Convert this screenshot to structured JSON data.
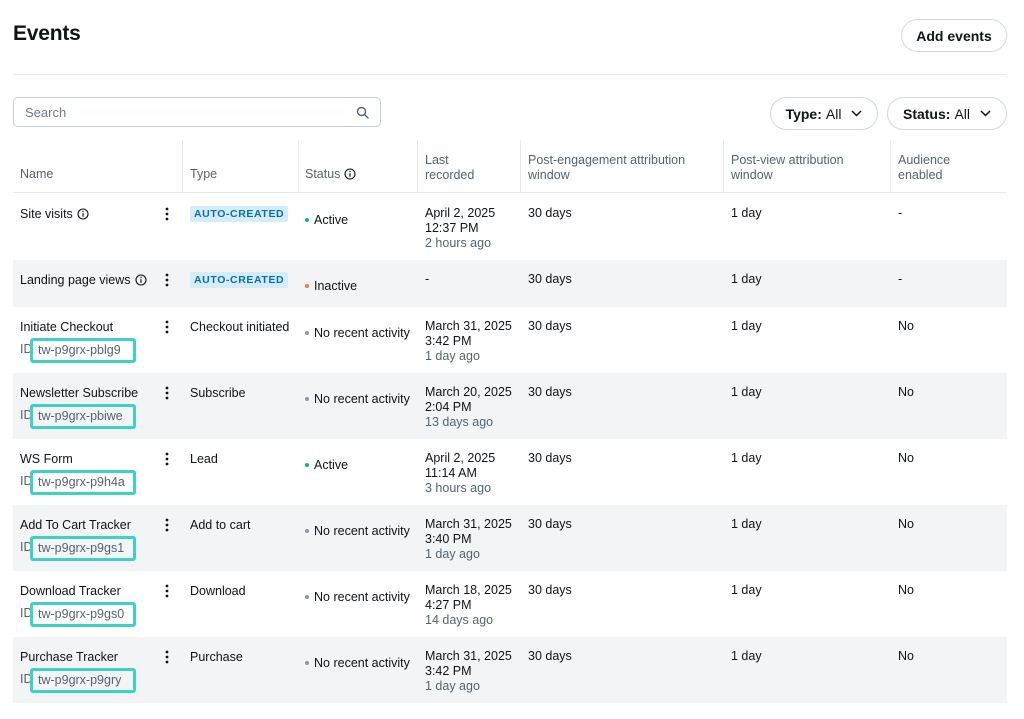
{
  "header": {
    "title": "Events",
    "add_button": "Add events"
  },
  "search": {
    "placeholder": "Search"
  },
  "filters": {
    "type": {
      "label": "Type:",
      "value": "All"
    },
    "status": {
      "label": "Status:",
      "value": "All"
    }
  },
  "columns": {
    "name": "Name",
    "type": "Type",
    "status": "Status",
    "last_recorded_1": "Last",
    "last_recorded_2": "recorded",
    "post_engagement_1": "Post-engagement attribution",
    "post_engagement_2": "window",
    "post_view_1": "Post-view attribution",
    "post_view_2": "window",
    "audience_1": "Audience",
    "audience_2": "enabled"
  },
  "id_prefix": "ID",
  "colors": {
    "active": "#00ba7c",
    "inactive": "#f57c2e",
    "no_recent": "#8b98a5",
    "highlight": "#3dd2c3",
    "badge_bg": "#d5ecfb",
    "badge_text": "#0a6fa8"
  },
  "rows": [
    {
      "name": "Site visits",
      "has_info": true,
      "type": "AUTO-CREATED",
      "type_badge": true,
      "status": "Active",
      "status_kind": "active",
      "last_date": "April 2, 2025",
      "last_time": "12:37 PM",
      "last_ago": "2 hours ago",
      "post_engagement": "30 days",
      "post_view": "1 day",
      "audience": "-"
    },
    {
      "name": "Landing page views",
      "has_info": true,
      "type": "AUTO-CREATED",
      "type_badge": true,
      "status": "Inactive",
      "status_kind": "inactive",
      "last_date": "-",
      "last_time": "",
      "last_ago": "",
      "post_engagement": "30 days",
      "post_view": "1 day",
      "audience": "-"
    },
    {
      "name": "Initiate Checkout",
      "id": "tw-p9grx-pblg9",
      "type": "Checkout initiated",
      "status": "No recent activity",
      "status_kind": "no_recent",
      "last_date": "March 31, 2025",
      "last_time": "3:42 PM",
      "last_ago": "1 day ago",
      "post_engagement": "30 days",
      "post_view": "1 day",
      "audience": "No"
    },
    {
      "name": "Newsletter Subscribe",
      "id": "tw-p9grx-pbiwe",
      "type": "Subscribe",
      "status": "No recent activity",
      "status_kind": "no_recent",
      "last_date": "March 20, 2025",
      "last_time": "2:04 PM",
      "last_ago": "13 days ago",
      "post_engagement": "30 days",
      "post_view": "1 day",
      "audience": "No"
    },
    {
      "name": "WS Form",
      "id": "tw-p9grx-p9h4a",
      "type": "Lead",
      "status": "Active",
      "status_kind": "active",
      "last_date": "April 2, 2025",
      "last_time": "11:14 AM",
      "last_ago": "3 hours ago",
      "post_engagement": "30 days",
      "post_view": "1 day",
      "audience": "No"
    },
    {
      "name": "Add To Cart Tracker",
      "id": "tw-p9grx-p9gs1",
      "type": "Add to cart",
      "status": "No recent activity",
      "status_kind": "no_recent",
      "last_date": "March 31, 2025",
      "last_time": "3:40 PM",
      "last_ago": "1 day ago",
      "post_engagement": "30 days",
      "post_view": "1 day",
      "audience": "No"
    },
    {
      "name": "Download Tracker",
      "id": "tw-p9grx-p9gs0",
      "type": "Download",
      "status": "No recent activity",
      "status_kind": "no_recent",
      "last_date": "March 18, 2025",
      "last_time": "4:27 PM",
      "last_ago": "14 days ago",
      "post_engagement": "30 days",
      "post_view": "1 day",
      "audience": "No"
    },
    {
      "name": "Purchase Tracker",
      "id": "tw-p9grx-p9gry",
      "type": "Purchase",
      "status": "No recent activity",
      "status_kind": "no_recent",
      "last_date": "March 31, 2025",
      "last_time": "3:42 PM",
      "last_ago": "1 day ago",
      "post_engagement": "30 days",
      "post_view": "1 day",
      "audience": "No"
    }
  ]
}
